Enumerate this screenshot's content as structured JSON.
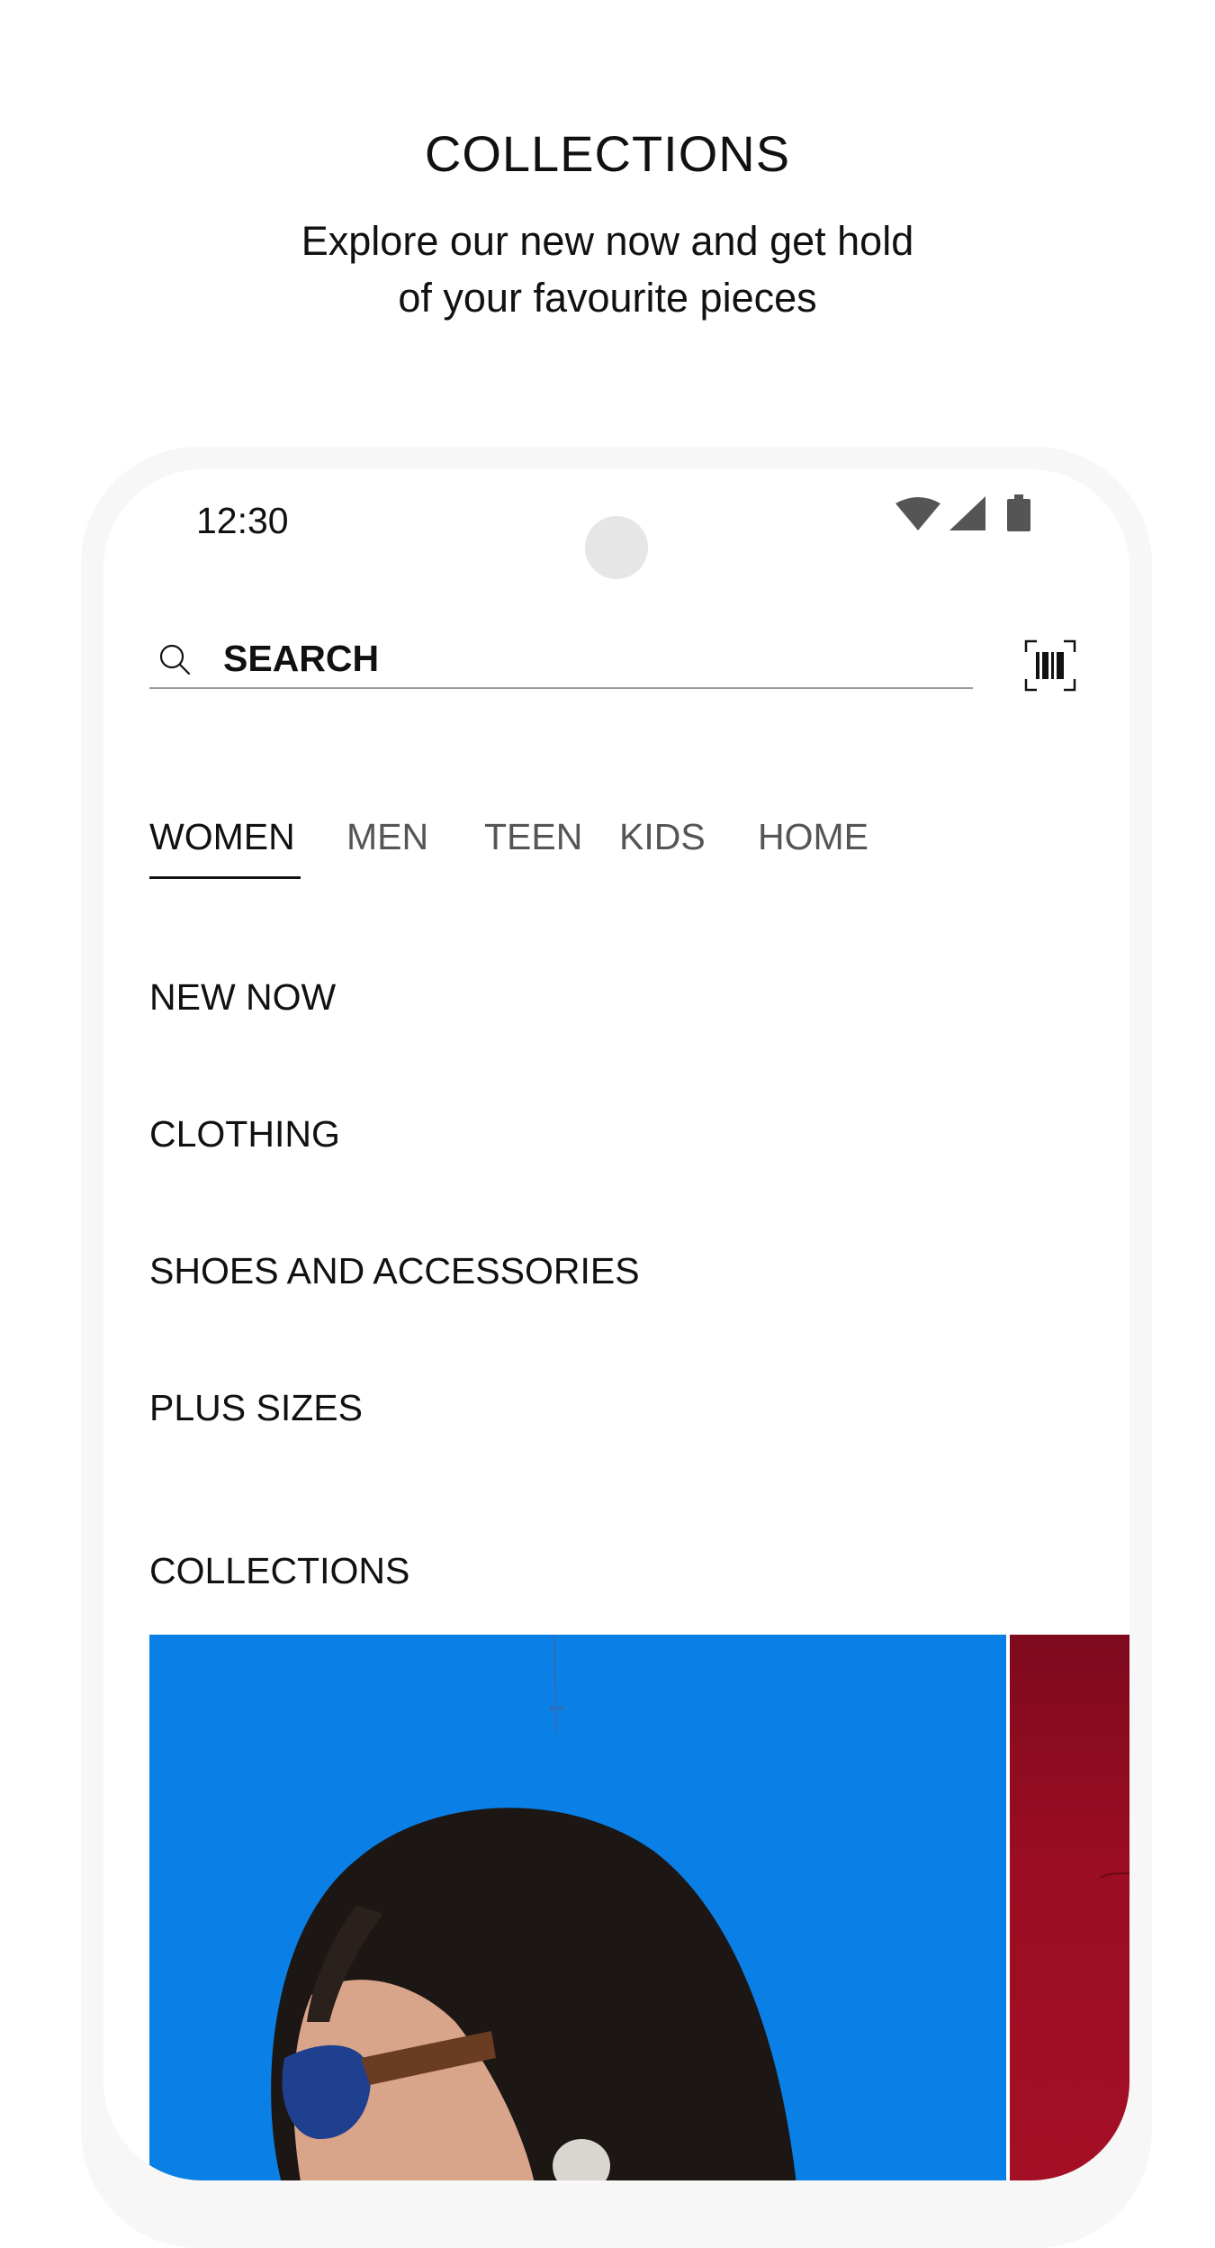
{
  "promo": {
    "title": "COLLECTIONS",
    "subtitle_line1": "Explore our new now and get hold",
    "subtitle_line2": "of your favourite pieces"
  },
  "status_bar": {
    "time": "12:30",
    "icons": [
      "wifi-icon",
      "signal-icon",
      "battery-icon"
    ]
  },
  "search": {
    "placeholder": "SEARCH",
    "value": "",
    "icon": "search-icon",
    "barcode_icon": "barcode-scanner-icon"
  },
  "tabs": [
    {
      "label": "WOMEN",
      "active": true
    },
    {
      "label": "MEN",
      "active": false
    },
    {
      "label": "TEEN",
      "active": false
    },
    {
      "label": "KIDS",
      "active": false
    },
    {
      "label": "HOME",
      "active": false
    }
  ],
  "menu": [
    {
      "label": "NEW NOW"
    },
    {
      "label": "CLOTHING"
    },
    {
      "label": "SHOES AND ACCESSORIES"
    },
    {
      "label": "PLUS SIZES"
    }
  ],
  "collections": {
    "heading": "COLLECTIONS"
  },
  "colors": {
    "primary_text": "#111111",
    "inactive_tab": "#555555",
    "collection_blue": "#0a7fe6",
    "collection_red": "#9a0d22",
    "device_frame": "#f7f7f7"
  }
}
